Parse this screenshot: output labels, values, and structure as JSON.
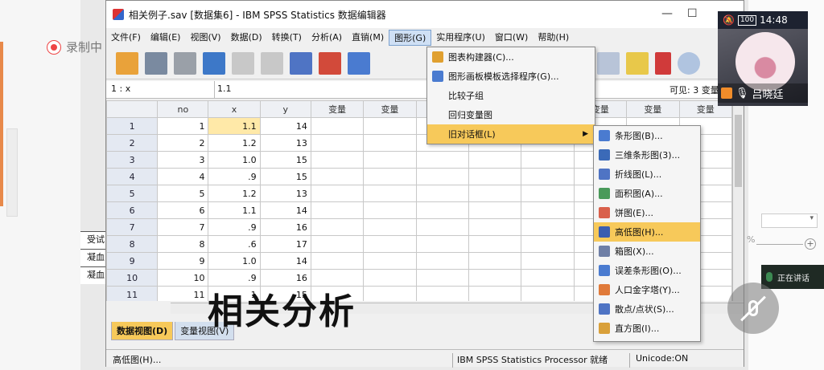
{
  "background": {
    "record_label": "录制中",
    "doc_rows": [
      "受试",
      "凝血",
      "凝血"
    ],
    "zoom_pct": "%",
    "dropdown_value": "",
    "speaking_label": "正在讲话"
  },
  "video": {
    "battery": "100",
    "time": "14:48",
    "participant_name": "吕晓廷"
  },
  "window": {
    "title": "相关例子.sav [数据集6] - IBM SPSS Statistics 数据编辑器",
    "menus": [
      "文件(F)",
      "编辑(E)",
      "视图(V)",
      "数据(D)",
      "转换(T)",
      "分析(A)",
      "直销(M)",
      "图形(G)",
      "实用程序(U)",
      "窗口(W)",
      "帮助(H)"
    ],
    "cell_ref": "1 : x",
    "cell_value": "1.1",
    "visible_label": "可见: 3 变量"
  },
  "grid": {
    "columns": [
      "no",
      "x",
      "y",
      "变量",
      "变量",
      "变量",
      "变量",
      "变量",
      "变量",
      "变量",
      "变量",
      "变"
    ],
    "rows": [
      {
        "row": "1",
        "no": "1",
        "x": "1.1",
        "y": "14"
      },
      {
        "row": "2",
        "no": "2",
        "x": "1.2",
        "y": "13"
      },
      {
        "row": "3",
        "no": "3",
        "x": "1.0",
        "y": "15"
      },
      {
        "row": "4",
        "no": "4",
        "x": ".9",
        "y": "15"
      },
      {
        "row": "5",
        "no": "5",
        "x": "1.2",
        "y": "13"
      },
      {
        "row": "6",
        "no": "6",
        "x": "1.1",
        "y": "14"
      },
      {
        "row": "7",
        "no": "7",
        "x": ".9",
        "y": "16"
      },
      {
        "row": "8",
        "no": "8",
        "x": ".6",
        "y": "17"
      },
      {
        "row": "9",
        "no": "9",
        "x": "1.0",
        "y": "14"
      },
      {
        "row": "10",
        "no": "10",
        "x": ".9",
        "y": "16"
      },
      {
        "row": "11",
        "no": "11",
        "x": "1",
        "y": "15"
      }
    ]
  },
  "tabs": {
    "data_view": "数据视图(D)",
    "variable_view": "变量视图(V)"
  },
  "status": {
    "left": "高低图(H)...",
    "processor": "IBM SPSS Statistics Processor 就绪",
    "unicode": "Unicode:ON"
  },
  "caption": "相关分析",
  "graphs_menu": [
    {
      "label": "图表构建器(C)...",
      "icon": "bar-chart-icon"
    },
    {
      "label": "图形画板模板选择程序(G)...",
      "icon": "template-icon"
    },
    {
      "label": "比较子组",
      "icon": ""
    },
    {
      "label": "回归变量图",
      "icon": ""
    },
    {
      "label": "旧对话框(L)",
      "icon": "",
      "submenu": true
    }
  ],
  "legacy_menu": [
    {
      "label": "条形图(B)...",
      "icon": "bar-icon",
      "color": "#4a7bd0"
    },
    {
      "label": "三维条形图(3)...",
      "icon": "bar3d-icon",
      "color": "#3b6ab8"
    },
    {
      "label": "折线图(L)...",
      "icon": "line-icon",
      "color": "#4f74c4"
    },
    {
      "label": "面积图(A)...",
      "icon": "area-icon",
      "color": "#4a9a5a"
    },
    {
      "label": "饼图(E)...",
      "icon": "pie-icon",
      "color": "#d9604b"
    },
    {
      "label": "高低图(H)...",
      "icon": "highlow-icon",
      "color": "#3a5db0"
    },
    {
      "label": "箱图(X)...",
      "icon": "box-icon",
      "color": "#6f7fa6"
    },
    {
      "label": "误差条形图(O)...",
      "icon": "errorbar-icon",
      "color": "#4a7bd0"
    },
    {
      "label": "人口金字塔(Y)...",
      "icon": "pyramid-icon",
      "color": "#e07a3a"
    },
    {
      "label": "散点/点状(S)...",
      "icon": "scatter-icon",
      "color": "#4f74c4"
    },
    {
      "label": "直方图(I)...",
      "icon": "histogram-icon",
      "color": "#d9a03a"
    }
  ]
}
